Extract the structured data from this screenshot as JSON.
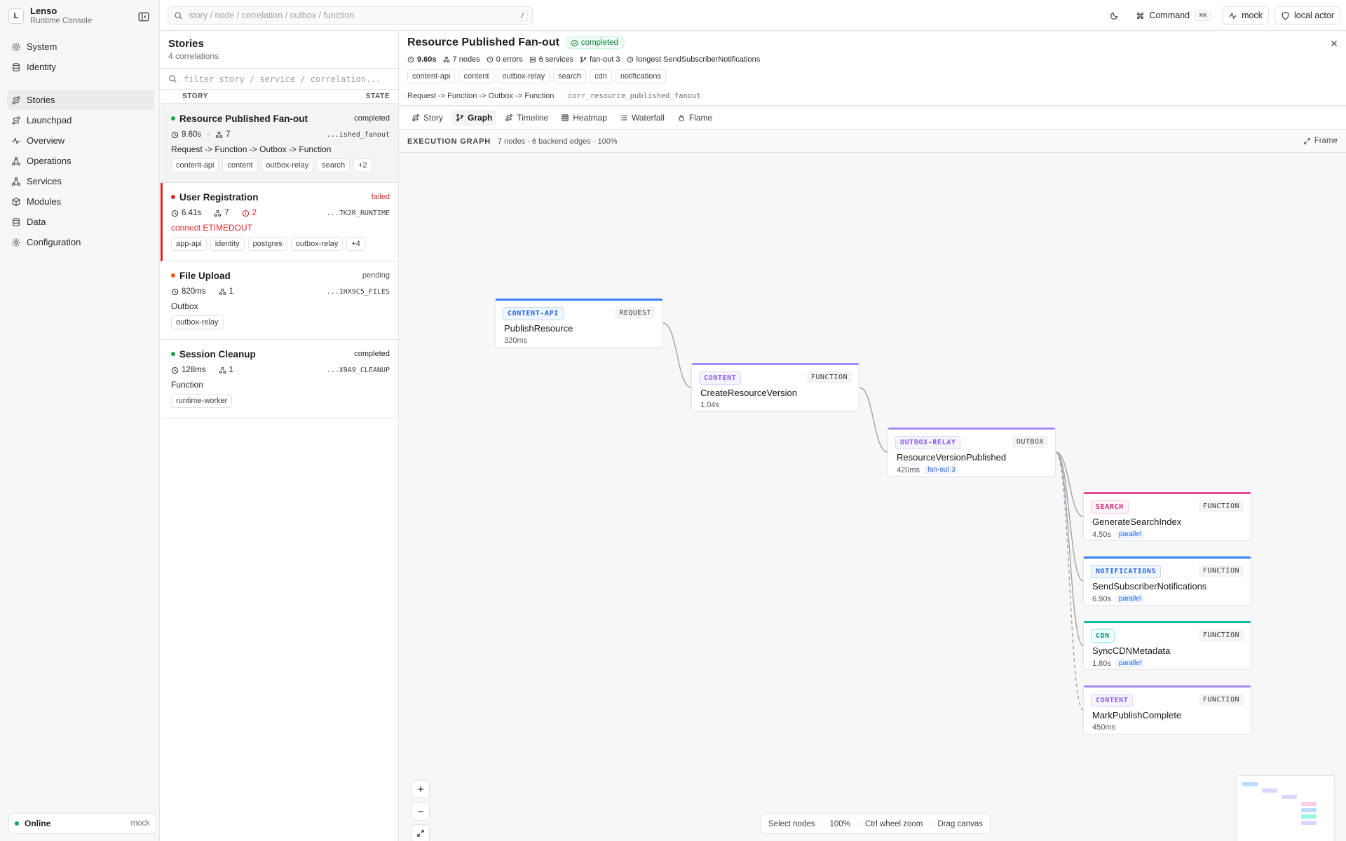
{
  "app": {
    "logo_letter": "L",
    "name": "Lenso",
    "subtitle": "Runtime Console"
  },
  "sidebar": {
    "groups": [
      [
        {
          "label": "System",
          "icon": "gear-icon"
        },
        {
          "label": "Identity",
          "icon": "database-icon"
        }
      ],
      [
        {
          "label": "Stories",
          "icon": "route-icon",
          "active": true
        },
        {
          "label": "Launchpad",
          "icon": "route-icon"
        },
        {
          "label": "Overview",
          "icon": "activity-icon"
        },
        {
          "label": "Operations",
          "icon": "network-icon"
        },
        {
          "label": "Services",
          "icon": "network-icon"
        },
        {
          "label": "Modules",
          "icon": "box-icon"
        },
        {
          "label": "Data",
          "icon": "database-icon"
        },
        {
          "label": "Configuration",
          "icon": "gear-icon"
        }
      ]
    ],
    "status": {
      "label": "Online",
      "mode": "mock",
      "color": "#16a34a"
    }
  },
  "topbar": {
    "search_placeholder": "story / node / correlation / outbox / function",
    "search_shortcut": "/",
    "command_label": "Command",
    "command_shortcut": "⌘K",
    "mode_label": "mock",
    "actor_label": "local actor"
  },
  "stories": {
    "title": "Stories",
    "count": "4 correlations",
    "filter_placeholder": "filter story / service / correlation...",
    "col_story": "STORY",
    "col_state": "STATE",
    "items": [
      {
        "name": "Resource Published Fan-out",
        "state": "completed",
        "state_class": "completed",
        "dot": "#16a34a",
        "duration": "9.60s",
        "sep": "·",
        "nodes": "7",
        "errors": "",
        "corr": "...ished_fanout",
        "path": "Request -> Function -> Outbox -> Function",
        "tags": [
          "content-api",
          "content",
          "outbox-relay",
          "search",
          "+2"
        ],
        "selected": true
      },
      {
        "name": "User Registration",
        "state": "failed",
        "state_class": "failed",
        "dot": "#dc2626",
        "duration": "6.41s",
        "sep": "",
        "nodes": "7",
        "errors": "2",
        "corr": "...7K2R_RUNTIME",
        "path": "connect ETIMEDOUT",
        "path_err": true,
        "tags": [
          "app-api",
          "identity",
          "postgres",
          "outbox-relay",
          "+4"
        ]
      },
      {
        "name": "File Upload",
        "state": "pending",
        "state_class": "pending",
        "dot": "#ea580c",
        "duration": "820ms",
        "sep": "",
        "nodes": "1",
        "errors": "",
        "corr": "...1HX9C5_FILES",
        "path": "Outbox",
        "tags": [
          "outbox-relay"
        ]
      },
      {
        "name": "Session Cleanup",
        "state": "completed",
        "state_class": "completed",
        "dot": "#16a34a",
        "duration": "128ms",
        "sep": "",
        "nodes": "1",
        "errors": "",
        "corr": "...X9A9_CLEANUP",
        "path": "Function",
        "tags": [
          "runtime-worker"
        ]
      }
    ]
  },
  "detail": {
    "title": "Resource Published Fan-out",
    "status": "completed",
    "meta": {
      "duration": "9.60s",
      "nodes": "7 nodes",
      "errors": "0 errors",
      "services": "6 services",
      "fanout": "fan-out 3",
      "longest": "longest SendSubscriberNotifications"
    },
    "tags": [
      "content-api",
      "content",
      "outbox-relay",
      "search",
      "cdn",
      "notifications"
    ],
    "path": "Request -> Function -> Outbox -> Function",
    "path_sep": "·",
    "correlation": "corr_resource_published_fanout",
    "tabs": [
      {
        "label": "Story",
        "icon": "route-icon"
      },
      {
        "label": "Graph",
        "icon": "branch-icon",
        "active": true
      },
      {
        "label": "Timeline",
        "icon": "route-icon"
      },
      {
        "label": "Heatmap",
        "icon": "grid-icon"
      },
      {
        "label": "Waterfall",
        "icon": "list-icon"
      },
      {
        "label": "Flame",
        "icon": "flame-icon"
      }
    ],
    "graph_title": "EXECUTION GRAPH",
    "graph_info": "7 nodes · 6 backend edges · 100%",
    "frame_label": "Frame"
  },
  "graph": {
    "nodes": [
      {
        "id": "n1",
        "service": "CONTENT-API",
        "kind": "REQUEST",
        "fn": "PublishResource",
        "duration": "320ms",
        "chip": "",
        "color": "#3b82f6",
        "svc_bg": "#eff6ff",
        "svc_fg": "#2563eb"
      },
      {
        "id": "n2",
        "service": "CONTENT",
        "kind": "FUNCTION",
        "fn": "CreateResourceVersion",
        "duration": "1.04s",
        "chip": "",
        "color": "#a78bfa",
        "svc_bg": "#f5f3ff",
        "svc_fg": "#8b5cf6"
      },
      {
        "id": "n3",
        "service": "OUTBOX-RELAY",
        "kind": "OUTBOX",
        "fn": "ResourceVersionPublished",
        "duration": "420ms",
        "chip": "fan-out 3",
        "color": "#a78bfa",
        "svc_bg": "#f5f3ff",
        "svc_fg": "#8b5cf6"
      },
      {
        "id": "n4",
        "service": "SEARCH",
        "kind": "FUNCTION",
        "fn": "GenerateSearchIndex",
        "duration": "4.50s",
        "chip": "parallel",
        "color": "#ec4899",
        "svc_bg": "#fdf2f8",
        "svc_fg": "#db2777"
      },
      {
        "id": "n5",
        "service": "NOTIFICATIONS",
        "kind": "FUNCTION",
        "fn": "SendSubscriberNotifications",
        "duration": "6.90s",
        "chip": "parallel",
        "color": "#3b82f6",
        "svc_bg": "#eff6ff",
        "svc_fg": "#2563eb"
      },
      {
        "id": "n6",
        "service": "CDN",
        "kind": "FUNCTION",
        "fn": "SyncCDNMetadata",
        "duration": "1.80s",
        "chip": "parallel",
        "color": "#14b8a6",
        "svc_bg": "#f0fdfa",
        "svc_fg": "#0d9488"
      },
      {
        "id": "n7",
        "service": "CONTENT",
        "kind": "FUNCTION",
        "fn": "MarkPublishComplete",
        "duration": "450ms",
        "chip": "",
        "color": "#a78bfa",
        "svc_bg": "#f5f3ff",
        "svc_fg": "#8b5cf6"
      }
    ],
    "edges": [
      {
        "from": "n1",
        "to": "n2",
        "dashed": false
      },
      {
        "from": "n2",
        "to": "n3",
        "dashed": false
      },
      {
        "from": "n3",
        "to": "n4",
        "dashed": false
      },
      {
        "from": "n3",
        "to": "n5",
        "dashed": false
      },
      {
        "from": "n3",
        "to": "n6",
        "dashed": false
      },
      {
        "from": "n3",
        "to": "n7",
        "dashed": true
      }
    ],
    "hints": [
      "Select nodes",
      "100%",
      "Ctrl wheel zoom",
      "Drag canvas"
    ]
  }
}
